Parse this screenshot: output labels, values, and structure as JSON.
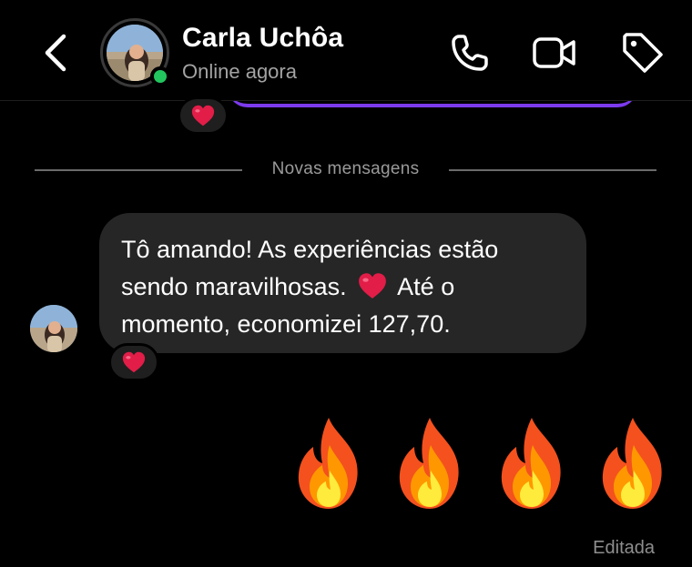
{
  "header": {
    "contact_name": "Carla Uchôa",
    "status": "Online agora",
    "back_icon": "chevron-left-icon",
    "actions": [
      "phone-icon",
      "video-icon",
      "tag-icon"
    ]
  },
  "divider": {
    "label": "Novas mensagens"
  },
  "messages": {
    "previous_reaction": "heart",
    "incoming": {
      "text_part1": "Tô amando! As experiências estão sendo maravilhosas.",
      "text_part2": "Até o momento, economizei 127,70.",
      "reaction": "heart"
    },
    "outgoing": {
      "emoji_count": 4,
      "emoji": "fire",
      "edited_label": "Editada"
    }
  },
  "colors": {
    "background": "#000000",
    "bubble": "#262626",
    "online": "#22c55e",
    "accent": "#7c3aed",
    "heart": "#e11d48"
  }
}
